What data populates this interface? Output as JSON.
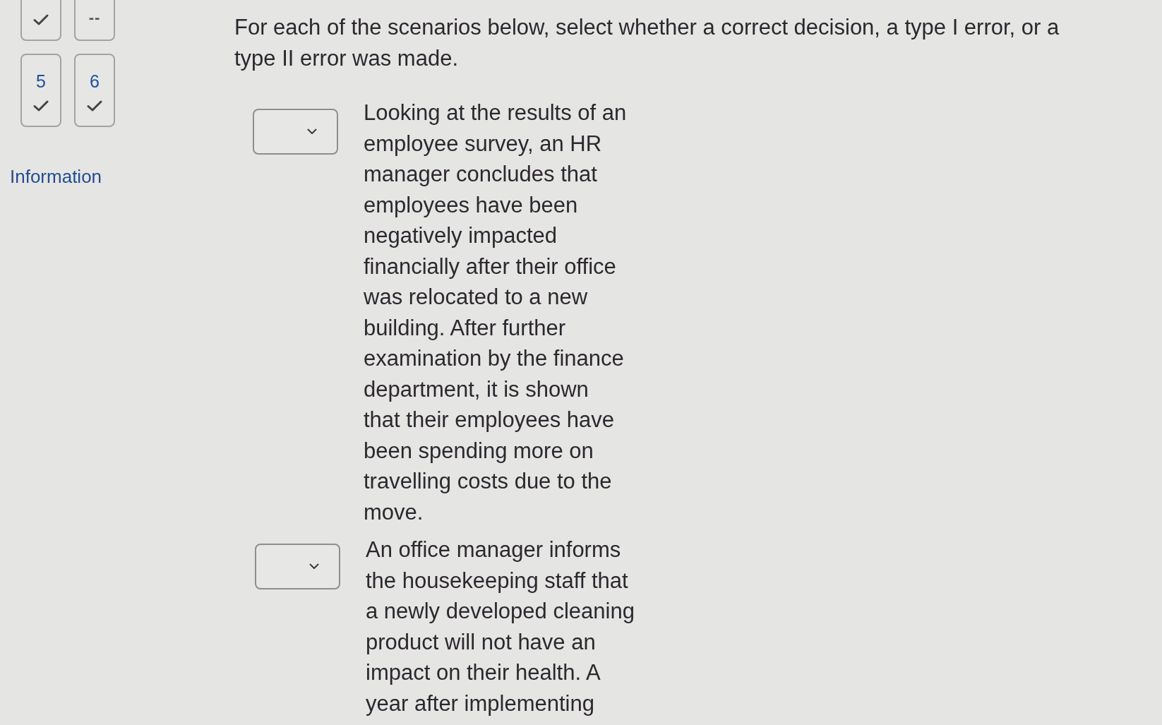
{
  "question_nav": [
    {
      "kind": "answered"
    },
    {
      "kind": "unanswered",
      "mark": "--"
    },
    {
      "number": "5",
      "kind": "answered"
    },
    {
      "number": "6",
      "kind": "answered"
    }
  ],
  "sidebar_link": "Information",
  "prompt": "For each of the scenarios below, select whether a correct decision, a type I error, or a type II error was made.",
  "scenarios": [
    {
      "text": "Looking at the results of an employee survey, an HR manager concludes that employees have been negatively impacted financially after their office was relocated to a new building. After further examination by the finance department, it is shown that their employees have been spending more on travelling costs due to the move."
    },
    {
      "text": "An office manager informs the housekeeping staff that a newly developed cleaning product will not have an impact on their health. A year after implementing"
    }
  ]
}
